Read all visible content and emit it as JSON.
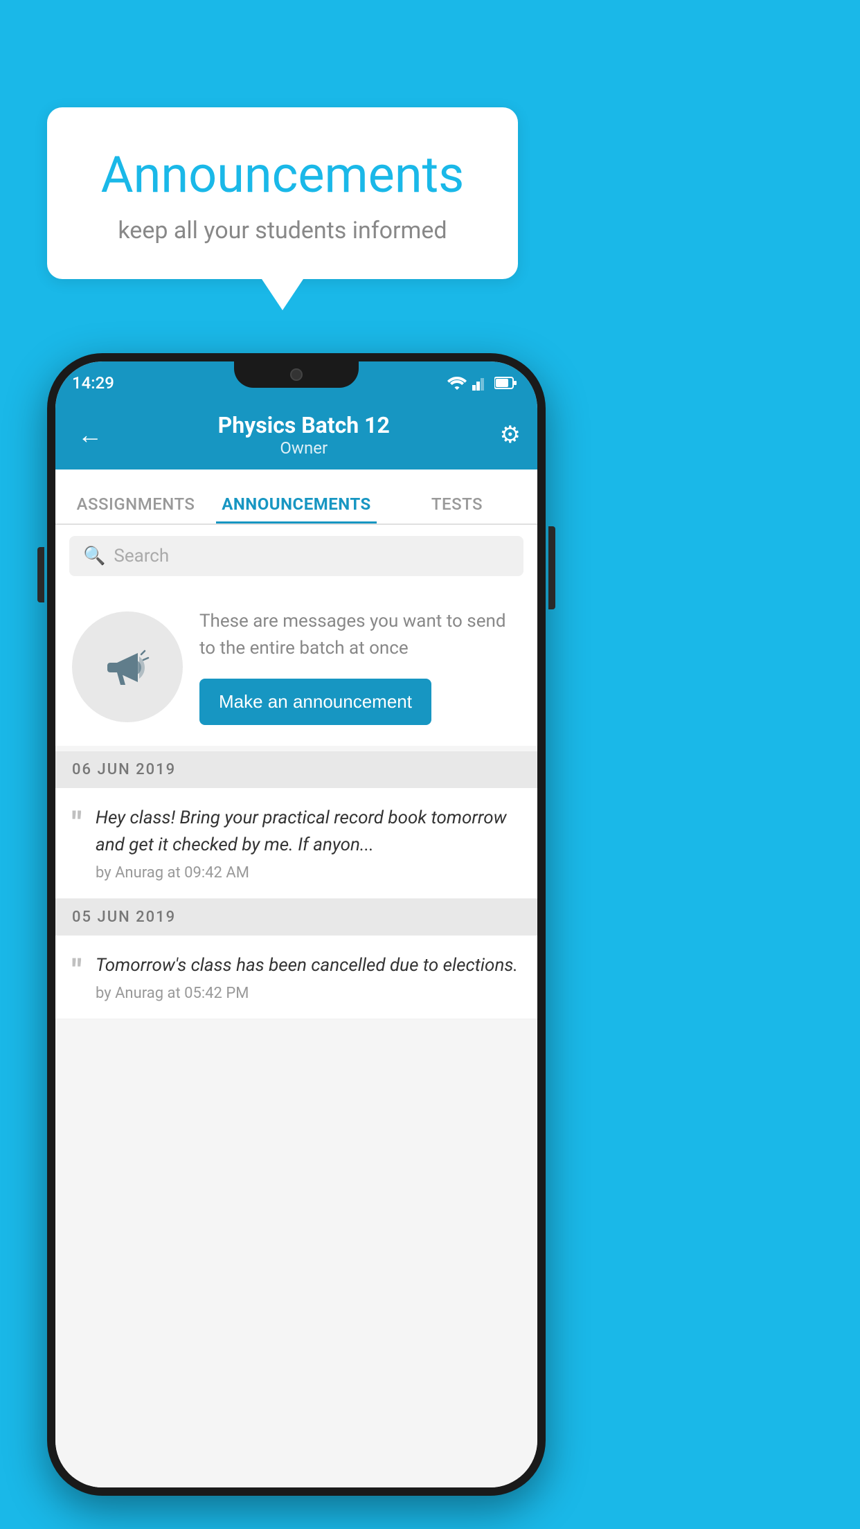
{
  "background_color": "#1ab8e8",
  "speech_bubble": {
    "title": "Announcements",
    "subtitle": "keep all your students informed"
  },
  "phone": {
    "status_bar": {
      "time": "14:29"
    },
    "app_bar": {
      "title": "Physics Batch 12",
      "subtitle": "Owner",
      "back_icon": "←",
      "settings_icon": "⚙"
    },
    "tabs": [
      {
        "label": "ASSIGNMENTS",
        "active": false
      },
      {
        "label": "ANNOUNCEMENTS",
        "active": true
      },
      {
        "label": "TESTS",
        "active": false
      }
    ],
    "search": {
      "placeholder": "Search"
    },
    "empty_state": {
      "description": "These are messages you want to send to the entire batch at once",
      "button_label": "Make an announcement"
    },
    "date_groups": [
      {
        "date": "06  JUN  2019",
        "announcements": [
          {
            "text": "Hey class! Bring your practical record book tomorrow and get it checked by me. If anyon...",
            "meta": "by Anurag at 09:42 AM"
          }
        ]
      },
      {
        "date": "05  JUN  2019",
        "announcements": [
          {
            "text": "Tomorrow's class has been cancelled due to elections.",
            "meta": "by Anurag at 05:42 PM"
          }
        ]
      }
    ]
  }
}
